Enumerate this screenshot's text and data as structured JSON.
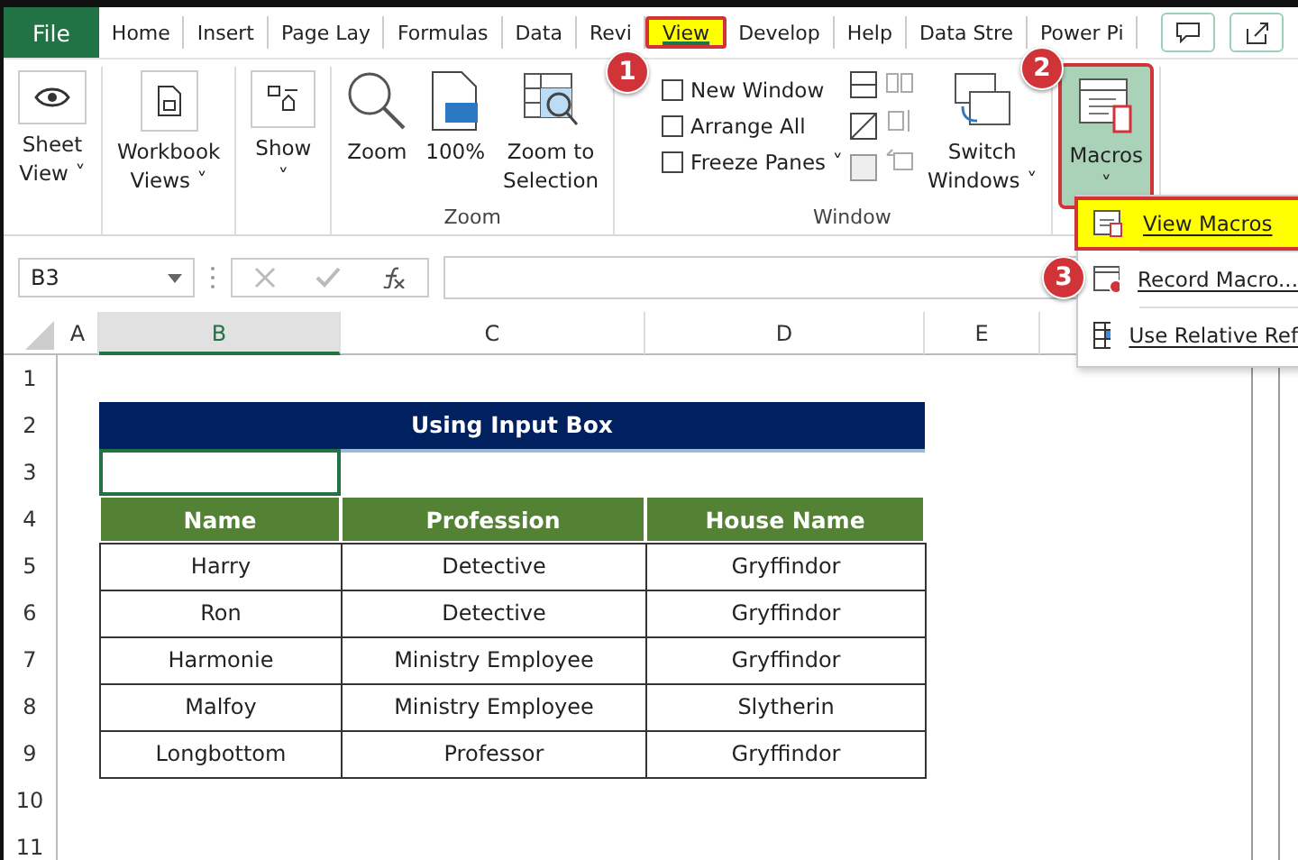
{
  "tabs": [
    {
      "label": "File",
      "kind": "file",
      "selected": false
    },
    {
      "label": "Home",
      "kind": "tab",
      "selected": false
    },
    {
      "label": "Insert",
      "kind": "tab",
      "selected": false
    },
    {
      "label": "Page Lay",
      "kind": "tab",
      "selected": false
    },
    {
      "label": "Formulas",
      "kind": "tab",
      "selected": false
    },
    {
      "label": "Data",
      "kind": "tab",
      "selected": false
    },
    {
      "label": "Revi",
      "kind": "tab",
      "selected": false
    },
    {
      "label": "View",
      "kind": "tab",
      "selected": true
    },
    {
      "label": "Develop",
      "kind": "tab",
      "selected": false
    },
    {
      "label": "Help",
      "kind": "tab",
      "selected": false
    },
    {
      "label": "Data Stre",
      "kind": "tab",
      "selected": false
    },
    {
      "label": "Power Pi",
      "kind": "tab",
      "selected": false
    }
  ],
  "ribbon": [
    {
      "buttons": [
        {
          "kind": "sheet",
          "lines": [
            "Sheet",
            "View ˅"
          ],
          "selected": false
        }
      ]
    },
    {
      "buttons": [
        {
          "kind": "workbook",
          "lines": [
            "Workbook",
            "Views ˅"
          ],
          "selected": false
        }
      ]
    },
    {
      "buttons": [
        {
          "kind": "show",
          "lines": [
            "Show",
            "˅"
          ],
          "selected": false
        }
      ]
    },
    {
      "label": "Zoom",
      "buttons": [
        {
          "kind": "zoom",
          "lines": [
            "Zoom"
          ],
          "selected": false
        },
        {
          "kind": "hundred",
          "lines": [
            "100%"
          ],
          "selected": false
        },
        {
          "kind": "selection",
          "lines": [
            "Zoom to",
            "Selection"
          ],
          "selected": false
        }
      ]
    },
    {
      "label": "Window",
      "small": [
        "New Window",
        "Arrange All",
        "Freeze Panes ˅"
      ],
      "buttons": [
        {
          "kind": "switch",
          "lines": [
            "Switch",
            "Windows ˅"
          ],
          "selected": false
        }
      ]
    },
    {
      "buttons": [
        {
          "kind": "macros",
          "lines": [
            "Macros",
            "˅"
          ],
          "selected": true
        }
      ]
    }
  ],
  "menu": [
    {
      "label": "View Macros",
      "kind": "view",
      "highlighted": true
    },
    {
      "label": "Record Macro...",
      "kind": "record",
      "highlighted": false
    },
    {
      "label": "Use Relative Ref",
      "kind": "relative",
      "highlighted": false
    }
  ],
  "callouts": [
    "1",
    "2",
    "3"
  ],
  "name_box": "B3",
  "columns": [
    {
      "label": "A",
      "selected": false
    },
    {
      "label": "B",
      "selected": true
    },
    {
      "label": "C",
      "selected": false
    },
    {
      "label": "D",
      "selected": false
    },
    {
      "label": "E",
      "selected": false
    }
  ],
  "row_numbers": [
    "1",
    "2",
    "3",
    "4",
    "5",
    "6",
    "7",
    "8",
    "9",
    "10",
    "11"
  ],
  "table": {
    "title": "Using Input Box",
    "input_cell_selected": true,
    "header": [
      "Name",
      "Profession",
      "House Name"
    ],
    "rows": [
      [
        "Harry",
        "Detective",
        "Gryffindor"
      ],
      [
        "Ron",
        "Detective",
        "Gryffindor"
      ],
      [
        "Harmonie",
        "Ministry Employee",
        "Gryffindor"
      ],
      [
        "Malfoy",
        "Ministry Employee",
        "Slytherin"
      ],
      [
        "Longbottom",
        "Professor",
        "Gryffindor"
      ]
    ]
  }
}
